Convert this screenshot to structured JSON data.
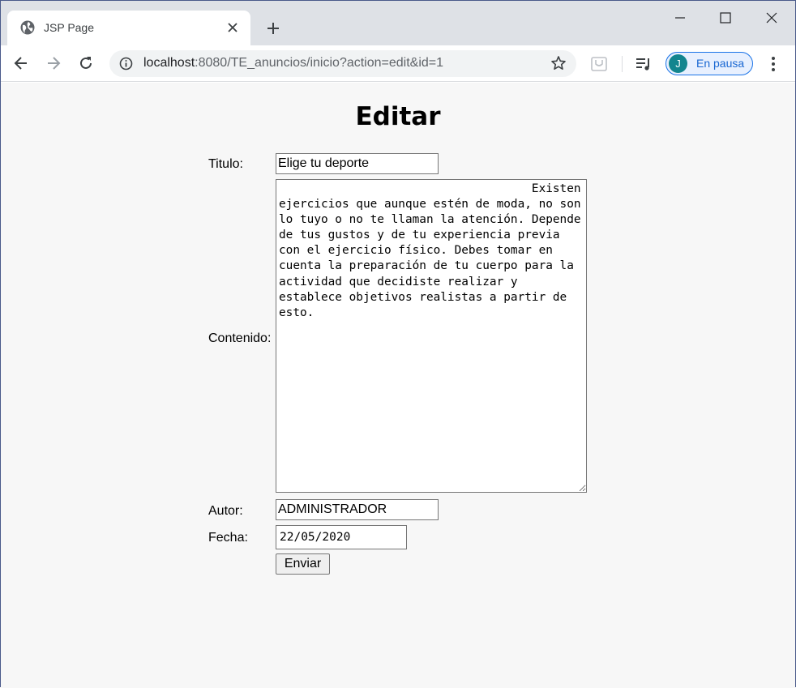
{
  "browser": {
    "tab_title": "JSP Page",
    "url_host": "localhost",
    "url_rest": ":8080/TE_anuncios/inicio?action=edit&id=1",
    "profile_initial": "J",
    "profile_status": "En pausa",
    "icons": [
      "globe-icon",
      "close-icon",
      "plus-icon",
      "minimize-icon",
      "maximize-icon",
      "window-close-icon",
      "back-icon",
      "forward-icon",
      "reload-icon",
      "info-icon",
      "star-icon",
      "extension-icon",
      "media-control-icon",
      "more-menu-icon"
    ],
    "colors": {
      "tabstrip": "#dee1e6",
      "accent": "#1a73e8",
      "avatar": "#12858f"
    }
  },
  "page": {
    "heading": "Editar",
    "form": {
      "titulo_label": "Titulo:",
      "titulo_value": "Elige tu deporte",
      "contenido_label": "Contenido:",
      "contenido_value": "                                    Existen ejercicios que aunque estén de moda, no son lo tuyo o no te llaman la atención. Depende de tus gustos y de tu experiencia previa con el ejercicio físico. Debes tomar en cuenta la preparación de tu cuerpo para la actividad que decidiste realizar y establece objetivos realistas a partir de esto.",
      "autor_label": "Autor:",
      "autor_value": "ADMINISTRADOR",
      "fecha_label": "Fecha:",
      "fecha_value": "22/05/2020",
      "submit_label": "Enviar"
    }
  }
}
